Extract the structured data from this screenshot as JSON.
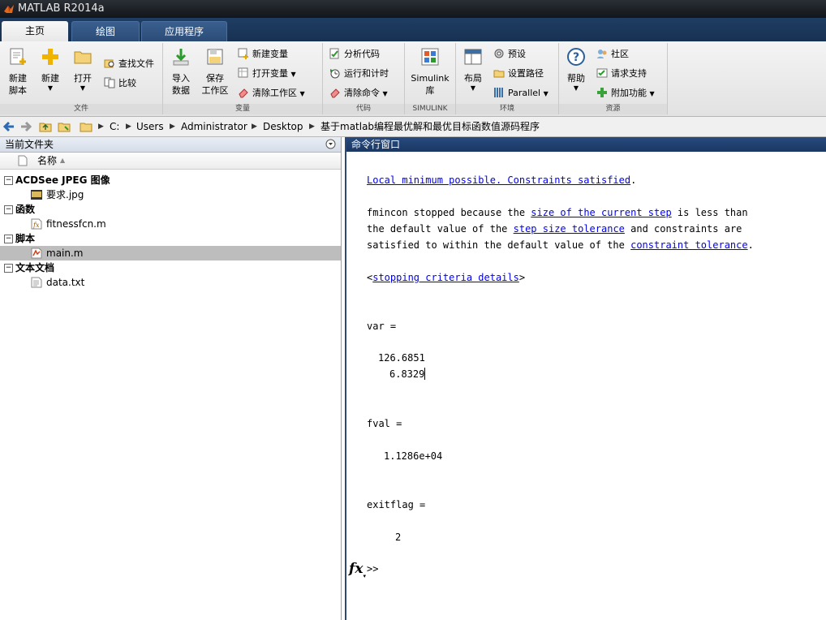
{
  "window": {
    "title": "MATLAB R2014a"
  },
  "tabs": [
    {
      "label": "主页",
      "active": true
    },
    {
      "label": "绘图",
      "active": false
    },
    {
      "label": "应用程序",
      "active": false
    }
  ],
  "ribbon": {
    "file": {
      "label": "文件",
      "new_script": [
        "新建",
        "脚本"
      ],
      "new": "新建",
      "open": "打开",
      "find_files": "查找文件",
      "compare": "比较"
    },
    "variable": {
      "label": "变量",
      "import": [
        "导入",
        "数据"
      ],
      "save_ws": [
        "保存",
        "工作区"
      ],
      "new_var": "新建变量",
      "open_var": "打开变量",
      "clear_ws": "清除工作区"
    },
    "code": {
      "label": "代码",
      "analyze": "分析代码",
      "run_time": "运行和计时",
      "clear_cmd": "清除命令"
    },
    "simulink": {
      "label": "SIMULINK",
      "lib": [
        "Simulink",
        "库"
      ]
    },
    "env": {
      "label": "环境",
      "layout": "布局",
      "prefs": "预设",
      "set_path": "设置路径",
      "parallel": "Parallel"
    },
    "resources": {
      "label": "资源",
      "help": "帮助",
      "community": "社区",
      "support": "请求支持",
      "addons": "附加功能"
    }
  },
  "address": {
    "crumbs": [
      "C:",
      "Users",
      "Administrator",
      "Desktop",
      "基于matlab编程最优解和最优目标函数值源码程序"
    ]
  },
  "current_folder": {
    "title": "当前文件夹",
    "col_name": "名称",
    "sort_indicator": "▲",
    "groups": [
      {
        "label": "ACDSee JPEG 图像",
        "files": [
          "要求.jpg"
        ]
      },
      {
        "label": "函数",
        "files": [
          "fitnessfcn.m"
        ]
      },
      {
        "label": "脚本",
        "files": [
          "main.m"
        ]
      },
      {
        "label": "文本文档",
        "files": [
          "data.txt"
        ]
      }
    ],
    "selected_file": "main.m"
  },
  "command_window": {
    "title": "命令行窗口",
    "local_min": "Local minimum possible. Constraints satisfied",
    "period": ".",
    "p1": "fmincon stopped because the ",
    "link_size_step": "size of the current step",
    "p2": " is less than",
    "p3": "the default value of the ",
    "link_step_tol": "step size tolerance",
    "p4": " and constraints are",
    "p5": "satisfied to within the default value of the ",
    "link_constr_tol": "constraint tolerance",
    "p6": ".",
    "lt": "<",
    "link_criteria": "stopping criteria details",
    "gt": ">",
    "var_label": "var =",
    "var_values": [
      "126.6851",
      "6.8329"
    ],
    "fval_label": "fval =",
    "fval_value": "1.1286e+04",
    "exitflag_label": "exitflag =",
    "exitflag_value": "2",
    "fx": "fx",
    "prompt": ">>"
  }
}
